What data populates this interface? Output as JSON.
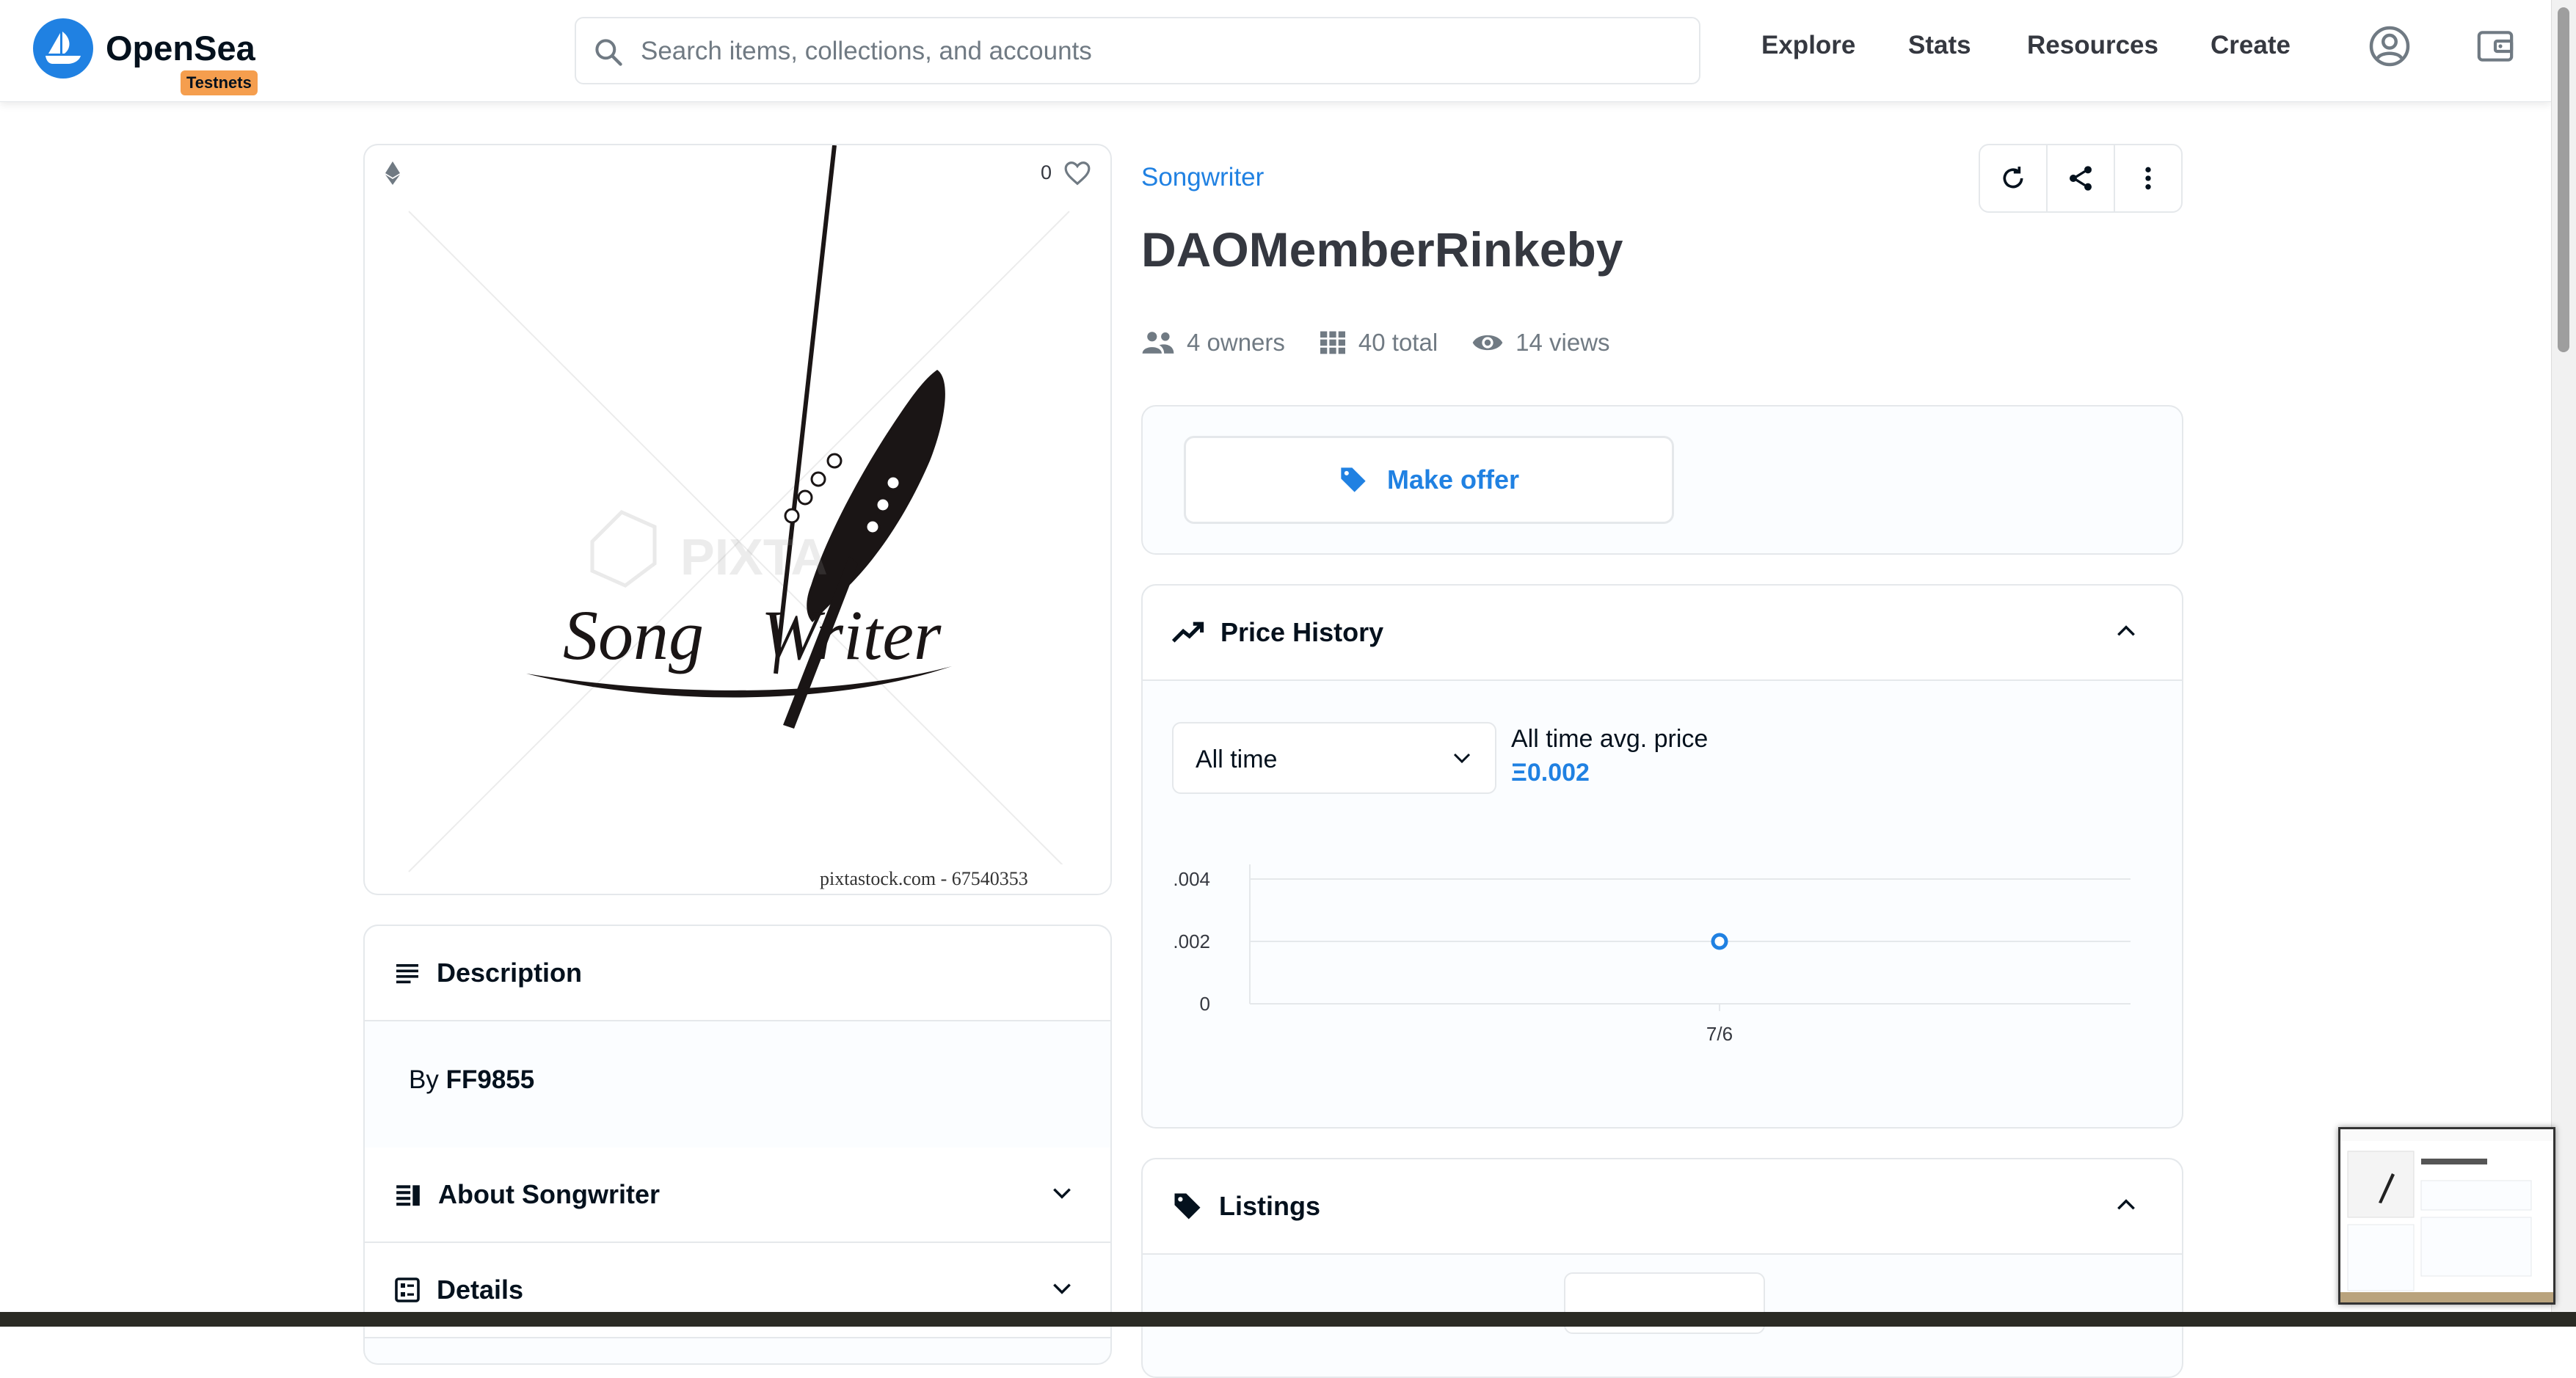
{
  "header": {
    "logo_text": "OpenSea",
    "badge": "Testnets",
    "search_placeholder": "Search items, collections, and accounts",
    "nav": [
      "Explore",
      "Stats",
      "Resources",
      "Create"
    ]
  },
  "asset": {
    "favorites": "0",
    "image_caption": "pixtastock.com - 67540353",
    "collection": "Songwriter",
    "title": "DAOMemberRinkeby",
    "stats": {
      "owners": "4 owners",
      "total": "40 total",
      "views": "14 views"
    }
  },
  "offer": {
    "label": "Make offer"
  },
  "price_history": {
    "title": "Price History",
    "range_selected": "All time",
    "avg_label": "All time avg. price",
    "avg_value": "Ξ0.002"
  },
  "chart_data": {
    "type": "scatter",
    "x": [
      "7/6"
    ],
    "y": [
      0.002
    ],
    "y_ticks": [
      ".004",
      ".002",
      "0"
    ],
    "x_ticks": [
      "7/6"
    ],
    "ylim": [
      0,
      0.004
    ],
    "grid": true,
    "point_color": "#2081e2"
  },
  "listings": {
    "title": "Listings"
  },
  "description": {
    "title": "Description",
    "by_prefix": "By",
    "creator": "FF9855",
    "about": "About Songwriter",
    "details": "Details"
  },
  "colors": {
    "accent": "#2081e2",
    "badge": "#f59e4e",
    "border": "#e5e8eb"
  }
}
